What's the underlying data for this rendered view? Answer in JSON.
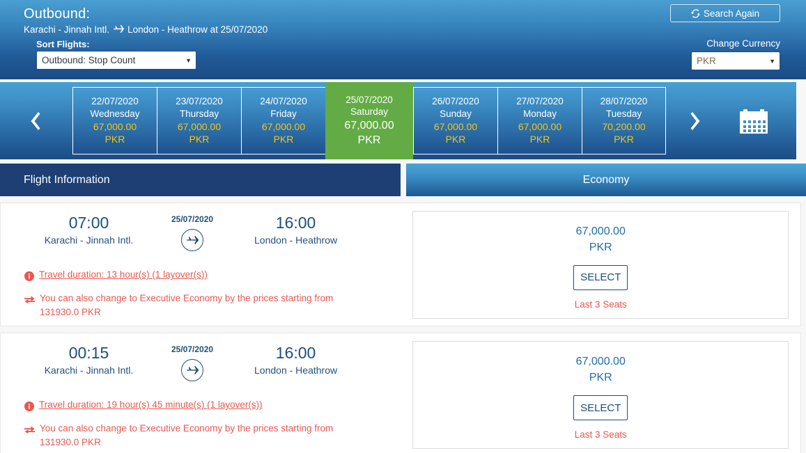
{
  "header": {
    "title": "Outbound:",
    "route_from": "Karachi - Jinnah Intl.",
    "route_icon": "plane-icon",
    "route_to": "London - Heathrow at 25/07/2020",
    "sort_label": "Sort Flights:",
    "sort_value": "Outbound: Stop Count",
    "search_again_label": "Search Again",
    "search_again_icon": "refresh-icon",
    "currency_label": "Change Currency",
    "currency_value": "PKR",
    "accent_blue": "#1d4f7a",
    "header_gradient_top": "#4a9ed1",
    "header_gradient_bottom": "#1b4b84"
  },
  "carousel": {
    "prev_icon": "chevron-left-icon",
    "next_icon": "chevron-right-icon",
    "calendar_icon": "calendar-icon",
    "price_color": "#f6c513",
    "selected_bg": "#63ab45",
    "dates": [
      {
        "date": "22/07/2020",
        "weekday": "Wednesday",
        "price": "67,000.00",
        "currency": "PKR",
        "selected": false
      },
      {
        "date": "23/07/2020",
        "weekday": "Thursday",
        "price": "67,000.00",
        "currency": "PKR",
        "selected": false
      },
      {
        "date": "24/07/2020",
        "weekday": "Friday",
        "price": "67,000.00",
        "currency": "PKR",
        "selected": false
      },
      {
        "date": "25/07/2020",
        "weekday": "Saturday",
        "price": "67,000.00",
        "currency": "PKR",
        "selected": true
      },
      {
        "date": "26/07/2020",
        "weekday": "Sunday",
        "price": "67,000.00",
        "currency": "PKR",
        "selected": false
      },
      {
        "date": "27/07/2020",
        "weekday": "Monday",
        "price": "67,000.00",
        "currency": "PKR",
        "selected": false
      },
      {
        "date": "28/07/2020",
        "weekday": "Tuesday",
        "price": "70,200.00",
        "currency": "PKR",
        "selected": false
      }
    ]
  },
  "columns": {
    "flight_information": "Flight Information",
    "cabin_class": "Economy"
  },
  "flights": [
    {
      "depart_time": "07:00",
      "depart_airport": "Karachi - Jinnah Intl.",
      "flight_date": "25/07/2020",
      "plane_icon": "plane-circle-icon",
      "arrive_time": "16:00",
      "arrive_airport": "London - Heathrow",
      "duration_icon": "info-icon",
      "duration_text": "Travel duration: 13 hour(s) (1 layover(s))",
      "upgrade_icon": "exchange-icon",
      "upgrade_text": "You can also change to Executive Economy by the prices starting from 131930.0 PKR",
      "price": "67,000.00",
      "currency": "PKR",
      "select_label": "SELECT",
      "seats_text": "Last 3 Seats"
    },
    {
      "depart_time": "00:15",
      "depart_airport": "Karachi - Jinnah Intl.",
      "flight_date": "25/07/2020",
      "plane_icon": "plane-circle-icon",
      "arrive_time": "16:00",
      "arrive_airport": "London - Heathrow",
      "duration_icon": "info-icon",
      "duration_text": "Travel duration: 19 hour(s) 45 minute(s) (1 layover(s))",
      "upgrade_icon": "exchange-icon",
      "upgrade_text": "You can also change to Executive Economy by the prices starting from 131930.0 PKR",
      "price": "67,000.00",
      "currency": "PKR",
      "select_label": "SELECT",
      "seats_text": "Last 3 Seats"
    }
  ]
}
